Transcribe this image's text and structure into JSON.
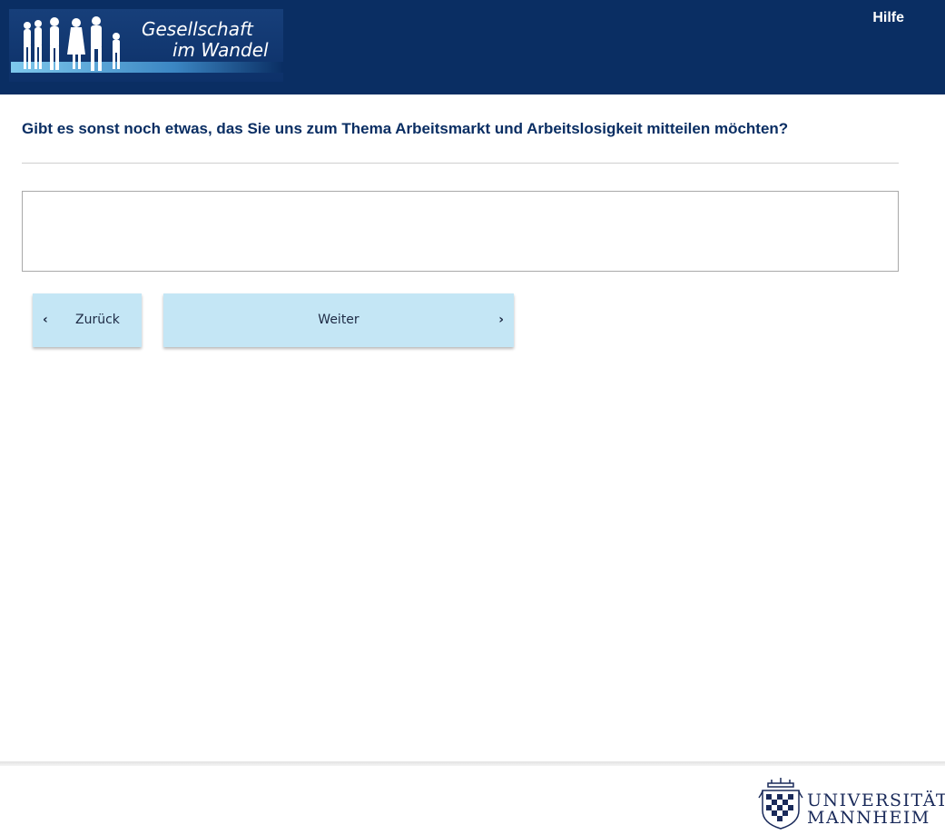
{
  "header": {
    "logo": {
      "line1": "Gesellschaft",
      "line2": "im Wandel"
    },
    "help_label": "Hilfe"
  },
  "question": {
    "text": "Gibt es sonst noch etwas, das Sie uns zum Thema Arbeitsmarkt und Arbeitslosigkeit mitteilen möchten?"
  },
  "answer": {
    "value": "",
    "placeholder": ""
  },
  "navigation": {
    "back_label": "Zurück",
    "next_label": "Weiter"
  },
  "footer": {
    "university_line1": "UNIVERSITÄT",
    "university_line2": "MANNHEIM"
  },
  "colors": {
    "header_bg": "#0a2e63",
    "button_bg": "#c4e6f5",
    "question_text": "#0a2e63"
  }
}
